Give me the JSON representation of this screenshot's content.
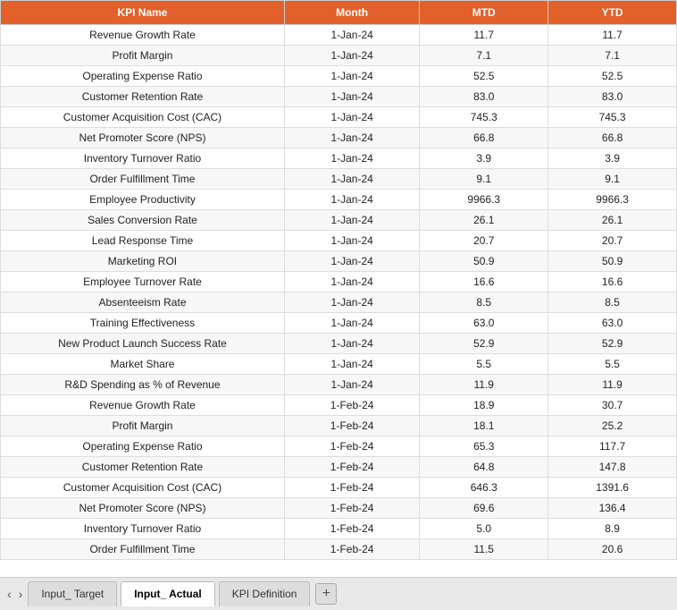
{
  "header": {
    "col1": "KPI Name",
    "col2": "Month",
    "col3": "MTD",
    "col4": "YTD"
  },
  "rows": [
    {
      "kpi": "Revenue Growth Rate",
      "month": "1-Jan-24",
      "mtd": "11.7",
      "ytd": "11.7"
    },
    {
      "kpi": "Profit Margin",
      "month": "1-Jan-24",
      "mtd": "7.1",
      "ytd": "7.1"
    },
    {
      "kpi": "Operating Expense Ratio",
      "month": "1-Jan-24",
      "mtd": "52.5",
      "ytd": "52.5"
    },
    {
      "kpi": "Customer Retention Rate",
      "month": "1-Jan-24",
      "mtd": "83.0",
      "ytd": "83.0"
    },
    {
      "kpi": "Customer Acquisition Cost (CAC)",
      "month": "1-Jan-24",
      "mtd": "745.3",
      "ytd": "745.3"
    },
    {
      "kpi": "Net Promoter Score (NPS)",
      "month": "1-Jan-24",
      "mtd": "66.8",
      "ytd": "66.8"
    },
    {
      "kpi": "Inventory Turnover Ratio",
      "month": "1-Jan-24",
      "mtd": "3.9",
      "ytd": "3.9"
    },
    {
      "kpi": "Order Fulfillment Time",
      "month": "1-Jan-24",
      "mtd": "9.1",
      "ytd": "9.1"
    },
    {
      "kpi": "Employee Productivity",
      "month": "1-Jan-24",
      "mtd": "9966.3",
      "ytd": "9966.3"
    },
    {
      "kpi": "Sales Conversion Rate",
      "month": "1-Jan-24",
      "mtd": "26.1",
      "ytd": "26.1"
    },
    {
      "kpi": "Lead Response Time",
      "month": "1-Jan-24",
      "mtd": "20.7",
      "ytd": "20.7"
    },
    {
      "kpi": "Marketing ROI",
      "month": "1-Jan-24",
      "mtd": "50.9",
      "ytd": "50.9"
    },
    {
      "kpi": "Employee Turnover Rate",
      "month": "1-Jan-24",
      "mtd": "16.6",
      "ytd": "16.6"
    },
    {
      "kpi": "Absenteeism Rate",
      "month": "1-Jan-24",
      "mtd": "8.5",
      "ytd": "8.5"
    },
    {
      "kpi": "Training Effectiveness",
      "month": "1-Jan-24",
      "mtd": "63.0",
      "ytd": "63.0"
    },
    {
      "kpi": "New Product Launch Success Rate",
      "month": "1-Jan-24",
      "mtd": "52.9",
      "ytd": "52.9"
    },
    {
      "kpi": "Market Share",
      "month": "1-Jan-24",
      "mtd": "5.5",
      "ytd": "5.5"
    },
    {
      "kpi": "R&D Spending as % of Revenue",
      "month": "1-Jan-24",
      "mtd": "11.9",
      "ytd": "11.9"
    },
    {
      "kpi": "Revenue Growth Rate",
      "month": "1-Feb-24",
      "mtd": "18.9",
      "ytd": "30.7"
    },
    {
      "kpi": "Profit Margin",
      "month": "1-Feb-24",
      "mtd": "18.1",
      "ytd": "25.2"
    },
    {
      "kpi": "Operating Expense Ratio",
      "month": "1-Feb-24",
      "mtd": "65.3",
      "ytd": "117.7"
    },
    {
      "kpi": "Customer Retention Rate",
      "month": "1-Feb-24",
      "mtd": "64.8",
      "ytd": "147.8"
    },
    {
      "kpi": "Customer Acquisition Cost (CAC)",
      "month": "1-Feb-24",
      "mtd": "646.3",
      "ytd": "1391.6"
    },
    {
      "kpi": "Net Promoter Score (NPS)",
      "month": "1-Feb-24",
      "mtd": "69.6",
      "ytd": "136.4"
    },
    {
      "kpi": "Inventory Turnover Ratio",
      "month": "1-Feb-24",
      "mtd": "5.0",
      "ytd": "8.9"
    },
    {
      "kpi": "Order Fulfillment Time",
      "month": "1-Feb-24",
      "mtd": "11.5",
      "ytd": "20.6"
    }
  ],
  "tabs": [
    {
      "label": "Input_ Target",
      "active": false
    },
    {
      "label": "Input_ Actual",
      "active": true
    },
    {
      "label": "KPI Definition",
      "active": false
    }
  ],
  "tab_add_label": "+",
  "nav_prev": "‹",
  "nav_next": "›"
}
